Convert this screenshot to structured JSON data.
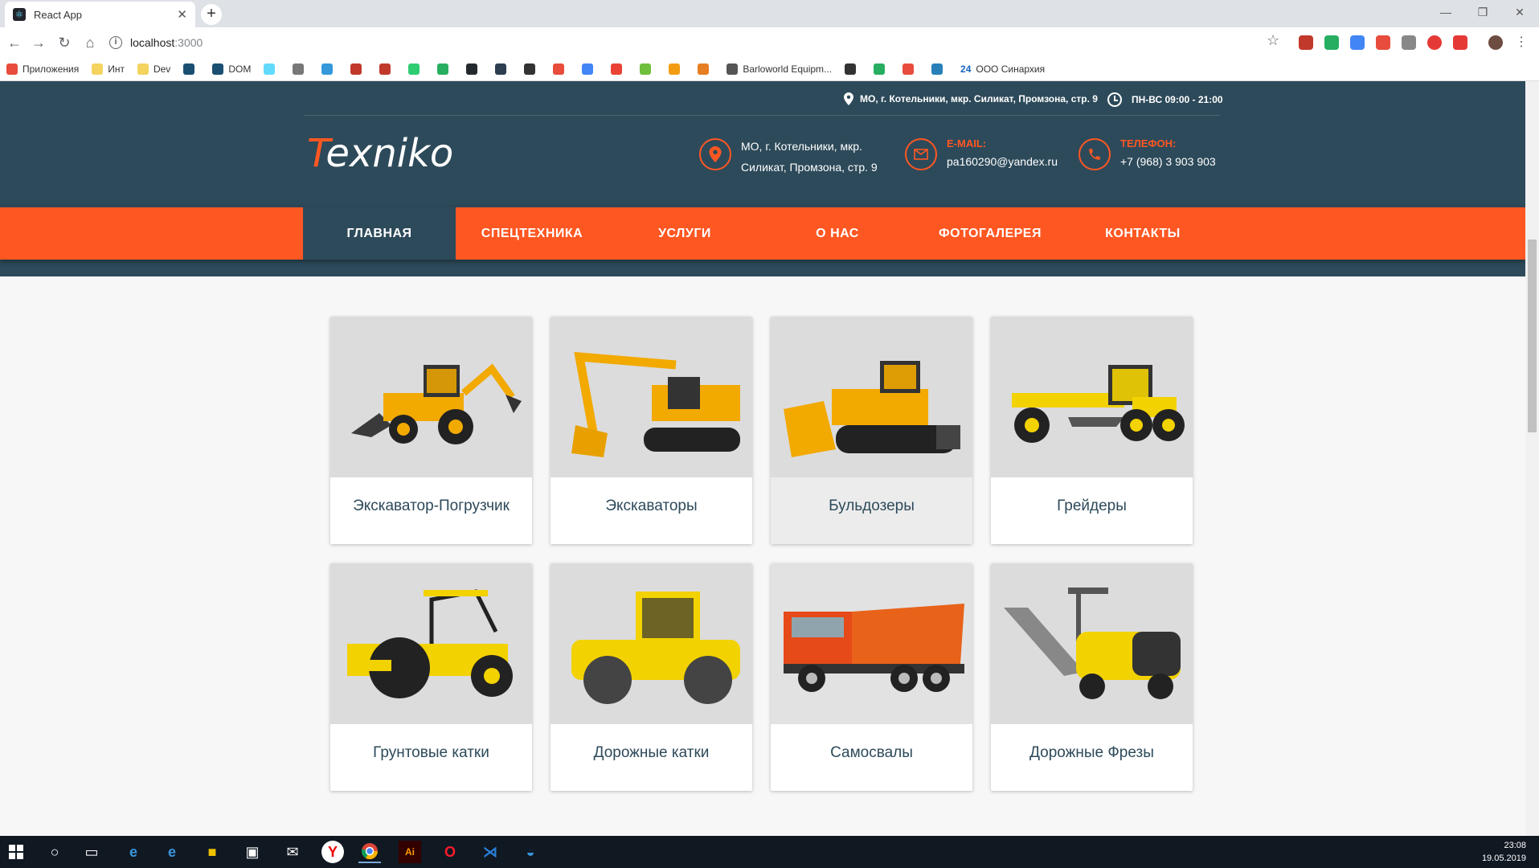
{
  "browser": {
    "tab_title": "React App",
    "url_host": "localhost",
    "url_port": ":3000",
    "bookmarks": [
      {
        "label": "Приложения",
        "color": "#e74c3c"
      },
      {
        "label": "Инт",
        "color": "#f4d35e"
      },
      {
        "label": "Dev",
        "color": "#f4d35e"
      },
      {
        "label": "",
        "color": "#1b4f72"
      },
      {
        "label": "DOM",
        "color": "#1b4f72"
      },
      {
        "label": "",
        "color": "#61dafb"
      },
      {
        "label": "",
        "color": "#777"
      },
      {
        "label": "",
        "color": "#3498db"
      },
      {
        "label": "",
        "color": "#c0392b"
      },
      {
        "label": "",
        "color": "#c0392b"
      },
      {
        "label": "",
        "color": "#2ecc71"
      },
      {
        "label": "",
        "color": "#27ae60"
      },
      {
        "label": "",
        "color": "#24292e"
      },
      {
        "label": "",
        "color": "#2c3e50"
      },
      {
        "label": "",
        "color": "#333"
      },
      {
        "label": "",
        "color": "#e74c3c"
      },
      {
        "label": "",
        "color": "#4285f4"
      },
      {
        "label": "",
        "color": "#ea4335"
      },
      {
        "label": "",
        "color": "#6fbf3b"
      },
      {
        "label": "",
        "color": "#f39c12"
      },
      {
        "label": "",
        "color": "#e67e22"
      },
      {
        "label": "Barloworld Equipm...",
        "color": "#555"
      },
      {
        "label": "",
        "color": "#333"
      },
      {
        "label": "",
        "color": "#27ae60"
      },
      {
        "label": "",
        "color": "#e74c3c"
      },
      {
        "label": "",
        "color": "#2980b9"
      },
      {
        "label": "ООО Синархия",
        "color": "#1565c0",
        "prefix": "24"
      }
    ]
  },
  "site": {
    "logo_first": "T",
    "logo_rest": "exniko",
    "top_address": "МО, г. Котельники, мкр. Силикат, Промзона, стр. 9",
    "top_hours": "ПН-ВС 09:00 - 21:00",
    "address_line1": "МО, г. Котельники, мкр.",
    "address_line2": "Силикат, Промзона, стр. 9",
    "email_label": "E-MAIL:",
    "email_value": "pa160290@yandex.ru",
    "phone_label": "ТЕЛЕФОН:",
    "phone_value": "+7 (968) 3 903 903",
    "nav": [
      "ГЛАВНАЯ",
      "СПЕЦТЕХНИКА",
      "УСЛУГИ",
      "О НАС",
      "ФОТОГАЛЕРЕЯ",
      "КОНТАКТЫ"
    ],
    "active_nav": "ГЛАВНАЯ",
    "cards": [
      {
        "title": "Экскаватор-Погрузчик",
        "icon": "backhoe-loader-image"
      },
      {
        "title": "Экскаваторы",
        "icon": "excavator-image"
      },
      {
        "title": "Бульдозеры",
        "icon": "bulldozer-image"
      },
      {
        "title": "Грейдеры",
        "icon": "grader-image"
      },
      {
        "title": "Грунтовые катки",
        "icon": "soil-roller-image"
      },
      {
        "title": "Дорожные катки",
        "icon": "road-roller-image"
      },
      {
        "title": "Самосвалы",
        "icon": "dump-truck-image"
      },
      {
        "title": "Дорожные Фрезы",
        "icon": "road-milling-image"
      }
    ]
  },
  "colors": {
    "header": "#2d4a5a",
    "accent": "#ff5722",
    "card_title": "#2d4a5a"
  },
  "taskbar": {
    "time": "23:08",
    "date": "19.05.2019"
  }
}
